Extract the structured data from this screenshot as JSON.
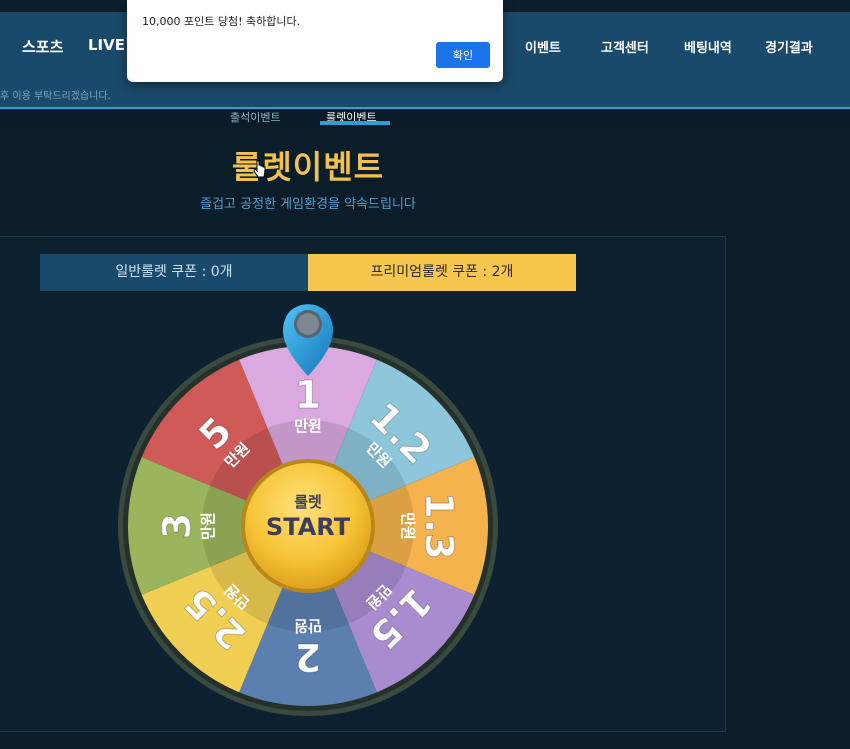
{
  "nav": {
    "items_left": [
      "스포츠",
      "LIVE"
    ],
    "items_right": [
      "이벤트",
      "고객센터",
      "베팅내역",
      "경기결과"
    ]
  },
  "notice": {
    "text": "후 이용 부탁드리겠습니다."
  },
  "subnav": {
    "tabs": [
      "출석이벤트",
      "룰렛이벤트"
    ],
    "active": "룰렛이벤트"
  },
  "hero": {
    "title": "룰렛이벤트",
    "subtitle": "즐겁고 공정한 게임환경을 약속드립니다"
  },
  "coupons": {
    "normal": "일반룰렛 쿠폰 : 0개",
    "premium": "프리미엄룰렛 쿠폰 : 2개"
  },
  "wheel": {
    "segments": [
      {
        "value": "1",
        "unit": "만원",
        "color": "#d9a9df"
      },
      {
        "value": "1.2",
        "unit": "만원",
        "color": "#8ec6db"
      },
      {
        "value": "1.3",
        "unit": "만원",
        "color": "#f4b34c"
      },
      {
        "value": "1.5",
        "unit": "만원",
        "color": "#a98ccf"
      },
      {
        "value": "2",
        "unit": "만원",
        "color": "#5b7fae"
      },
      {
        "value": "2.5",
        "unit": "만원",
        "color": "#f0cf52"
      },
      {
        "value": "3",
        "unit": "만원",
        "color": "#9bb55c"
      },
      {
        "value": "5",
        "unit": "만원",
        "color": "#cf5a57"
      }
    ],
    "center_top": "룰렛",
    "center_bottom": "START"
  },
  "dialog": {
    "message": "10,000 포인트 당첨! 축하합니다.",
    "confirm": "확인"
  },
  "colors": {
    "accent": "#2a9fd8",
    "gold": "#f2c14e",
    "navbar": "#1a4a6b"
  }
}
